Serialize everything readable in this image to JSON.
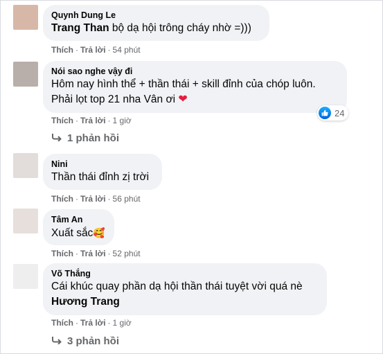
{
  "comments": [
    {
      "author": "Quynh Dung Le",
      "tag": "Trang Than",
      "text": " bộ dạ hội trông cháy nhờ =)))",
      "like": "Thích",
      "reply": "Trả lời",
      "time": "54 phút",
      "avatar_color": "#d7b8a8"
    },
    {
      "author": "Nói sao nghe vậy đi",
      "line1": "Hôm nay hình thể + thần thái + skill đỉnh của chóp luôn.",
      "line2": "Phải lọt top 21 nha Vân ơi",
      "emoji": "❤",
      "like": "Thích",
      "reply": "Trả lời",
      "time": "1 giờ",
      "reaction_count": "24",
      "reaction_icon": "like-icon",
      "replies_label": "1 phản hồi",
      "avatar_color": "#b8aeaa"
    },
    {
      "author": "Nini",
      "text": "Thần thái đỉnh zị trời",
      "like": "Thích",
      "reply": "Trả lời",
      "time": "56 phút",
      "avatar_color": "#e2dcda"
    },
    {
      "author": "Tâm An",
      "text": "Xuất sắc",
      "emoji": "🥰",
      "like": "Thích",
      "reply": "Trả lời",
      "time": "52 phút",
      "avatar_color": "#e6dfdc"
    },
    {
      "author": "Võ Thắng",
      "line1": "Cái khúc quay phần dạ hội thần thái tuyệt vời quá nè",
      "tag": "Hương Trang",
      "like": "Thích",
      "reply": "Trả lời",
      "time": "1 giờ",
      "replies_label": "3 phản hồi",
      "avatar_color": "#eeeeee"
    }
  ],
  "colors": {
    "bubble": "#f0f2f5",
    "meta_text": "#65676b",
    "like_blue": "#1877f2",
    "heart": "#e41e3f"
  }
}
